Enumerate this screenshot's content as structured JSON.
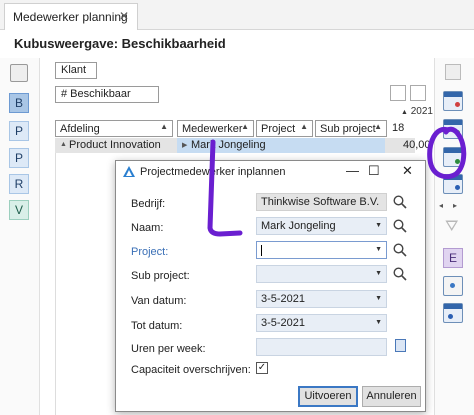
{
  "tab": {
    "label": "Medewerker planning",
    "close": "✕"
  },
  "page_title": "Kubusweergave: Beschikbaarheid",
  "left_toolbar": {
    "buttons": [
      "B",
      "P",
      "P",
      "R",
      "V"
    ]
  },
  "grid": {
    "filter_klant": "Klant",
    "filter_beschikbaar": "# Beschikbaar",
    "year": "2021",
    "columns": [
      "Afdeling",
      "Medewerker",
      "Project",
      "Sub project"
    ],
    "col_number": "18",
    "row": {
      "afdeling": "Product Innovation",
      "medewerker": "Mark Jongeling",
      "value": "40,00"
    }
  },
  "right_toolbar": {
    "e_button": "E",
    "nav_left": "◂",
    "nav_right": "▸"
  },
  "colors": {
    "accent": "#3b78c4",
    "annotation": "#6a1fd0"
  },
  "dialog": {
    "title": "Projectmedewerker inplannen",
    "controls": {
      "minimize": "—",
      "maximize": "☐",
      "close": "✕"
    },
    "fields": {
      "bedrijf": {
        "label": "Bedrijf:",
        "value": "Thinkwise Software B.V."
      },
      "naam": {
        "label": "Naam:",
        "value": "Mark Jongeling"
      },
      "project": {
        "label": "Project:",
        "value": ""
      },
      "sub_project": {
        "label": "Sub project:",
        "value": ""
      },
      "van_datum": {
        "label": "Van datum:",
        "value": "3-5-2021"
      },
      "tot_datum": {
        "label": "Tot datum:",
        "value": "3-5-2021"
      },
      "uren": {
        "label": "Uren per week:",
        "value": ""
      },
      "capaciteit": {
        "label": "Capaciteit overschrijven:",
        "checked": "✓"
      }
    },
    "buttons": {
      "execute": "Uitvoeren",
      "cancel": "Annuleren"
    }
  }
}
